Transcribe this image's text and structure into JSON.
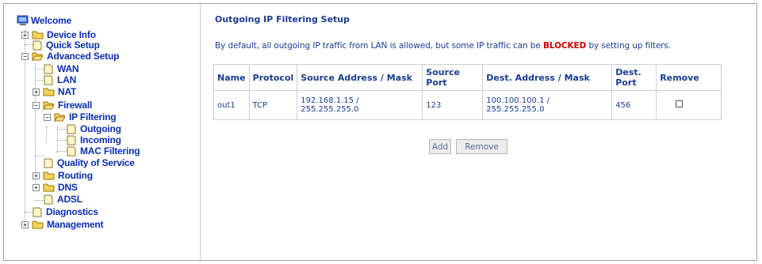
{
  "tree": {
    "welcome": "Welcome",
    "device_info": "Device Info",
    "quick_setup": "Quick Setup",
    "advanced_setup": "Advanced Setup",
    "wan": "WAN",
    "lan": "LAN",
    "nat": "NAT",
    "firewall": "Firewall",
    "ip_filtering": "IP Filtering",
    "outgoing": "Outgoing",
    "incoming": "Incoming",
    "mac_filtering": "MAC Filtering",
    "qos": "Quality of Service",
    "routing": "Routing",
    "dns": "DNS",
    "adsl": "ADSL",
    "diagnostics": "Diagnostics",
    "management": "Management"
  },
  "main": {
    "title": "Outgoing IP Filtering Setup",
    "desc_before": "By default, all outgoing IP traffic from LAN is allowed, but some IP traffic can be ",
    "desc_blocked": "BLOCKED",
    "desc_after": " by setting up filters.",
    "columns": [
      "Name",
      "Protocol",
      "Source Address / Mask",
      "Source Port",
      "Dest. Address / Mask",
      "Dest. Port",
      "Remove"
    ],
    "rows": [
      {
        "name": "out1",
        "protocol": "TCP",
        "src_addr": "192.168.1.15 / 255.255.255.0",
        "src_port": "123",
        "dest_addr": "100.100.100.1 / 255.255.255.0",
        "dest_port": "456",
        "remove_checked": false
      }
    ],
    "add_label": "Add",
    "remove_label": "Remove"
  },
  "colors": {
    "link": "#0b2fb0",
    "text": "#1a3c8f",
    "blocked": "#d00000",
    "folder": "#f2d35a"
  }
}
